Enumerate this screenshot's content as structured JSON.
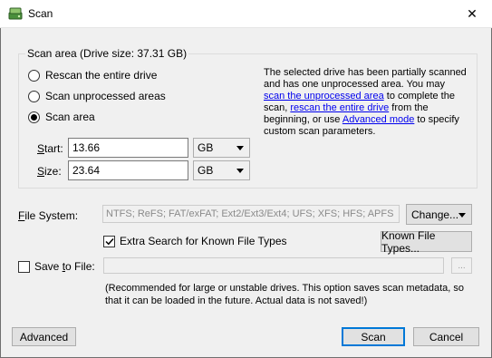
{
  "window": {
    "title": "Scan",
    "close_glyph": "✕"
  },
  "scan_area": {
    "group_label": "Scan area (Drive size: 37.31 GB)",
    "options": [
      {
        "label": "Rescan the entire drive",
        "selected": false
      },
      {
        "label": "Scan unprocessed areas",
        "selected": false
      },
      {
        "label": "Scan area",
        "selected": true
      }
    ],
    "start": {
      "label_prefix": "S",
      "label_rest": "tart:",
      "value": "13.66",
      "unit": "GB"
    },
    "size": {
      "label_prefix": "S",
      "label_rest": "ize:",
      "value": "23.64",
      "unit": "GB"
    },
    "description": {
      "part1": "The selected drive has been partially scanned and has one unprocessed area. You may ",
      "link1": "scan the unprocessed area",
      "part2": " to complete the scan, ",
      "link2": "rescan the entire drive",
      "part3": " from the beginning, or use ",
      "link3": "Advanced mode",
      "part4": " to specify custom scan parameters."
    }
  },
  "file_system": {
    "label_prefix": "F",
    "label_rest": "ile System:",
    "value": "NTFS; ReFS; FAT/exFAT; Ext2/Ext3/Ext4; UFS; XFS; HFS; APFS",
    "change_label": "Change...",
    "extra_search_label": "Extra Search for Known File Types",
    "extra_search_checked": true,
    "known_types_label": "Known File Types..."
  },
  "save": {
    "label_prefix": "Save ",
    "label_underlined": "t",
    "label_rest": "o File:",
    "checked": false,
    "path_value": "",
    "browse_label": "...",
    "note": "(Recommended for large or unstable drives. This option saves scan metadata, so that it can be loaded in the future. Actual data is not saved!)"
  },
  "buttons": {
    "advanced": "Advanced",
    "scan": "Scan",
    "cancel": "Cancel"
  },
  "colors": {
    "link": "#0000ee",
    "accent": "#0078d7"
  }
}
